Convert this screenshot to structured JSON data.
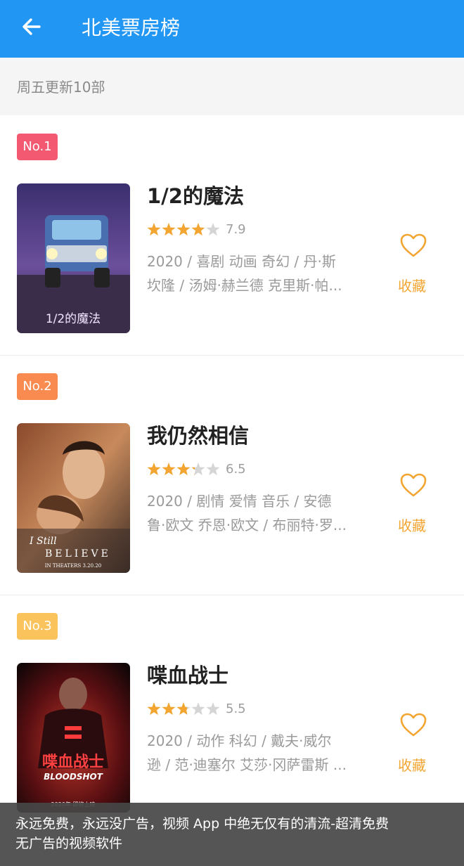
{
  "appbar": {
    "title": "北美票房榜",
    "back_icon": "arrow-left-icon"
  },
  "subheader": {
    "text": "周五更新10部"
  },
  "movies": [
    {
      "rank": "No.1",
      "rank_color": "#f35a72",
      "title": "1/2的魔法",
      "rating": 7.9,
      "rating_text": "7.9",
      "meta_line1": "2020 / 喜剧  动画  奇幻 / 丹·斯",
      "meta_line2": "坎隆 / 汤姆·赫兰德  克里斯·帕...",
      "fav_label": "收藏",
      "poster_text": "1/2的魔法"
    },
    {
      "rank": "No.2",
      "rank_color": "#f98b50",
      "title": "我仍然相信",
      "rating": 6.5,
      "rating_text": "6.5",
      "meta_line1": "2020 / 剧情  爱情  音乐 / 安德",
      "meta_line2": "鲁·欧文  乔恩·欧文 / 布丽特·罗...",
      "fav_label": "收藏",
      "poster_text_1": "I Still",
      "poster_text_2": "BELIEVE",
      "poster_text_3": "IN THEATERS 3.20.20"
    },
    {
      "rank": "No.3",
      "rank_color": "#fbc35c",
      "title": "喋血战士",
      "rating": 5.5,
      "rating_text": "5.5",
      "meta_line1": "2020 / 动作  科幻 / 戴夫·威尔",
      "meta_line2": "逊 / 范·迪塞尔  艾莎·冈萨雷斯  ...",
      "fav_label": "收藏",
      "poster_text_1": "喋血战士",
      "poster_text_2": "BLOODSHOT",
      "poster_text_3": "2020年 即将上映"
    }
  ],
  "colors": {
    "primary": "#2196F3",
    "star": "#f2a531",
    "accent": "#f2a531"
  },
  "toast": {
    "line1": "永远免费，永远没广告，视频 App 中绝无仅有的清流-超清免费",
    "line2": "无广告的视频软件"
  }
}
